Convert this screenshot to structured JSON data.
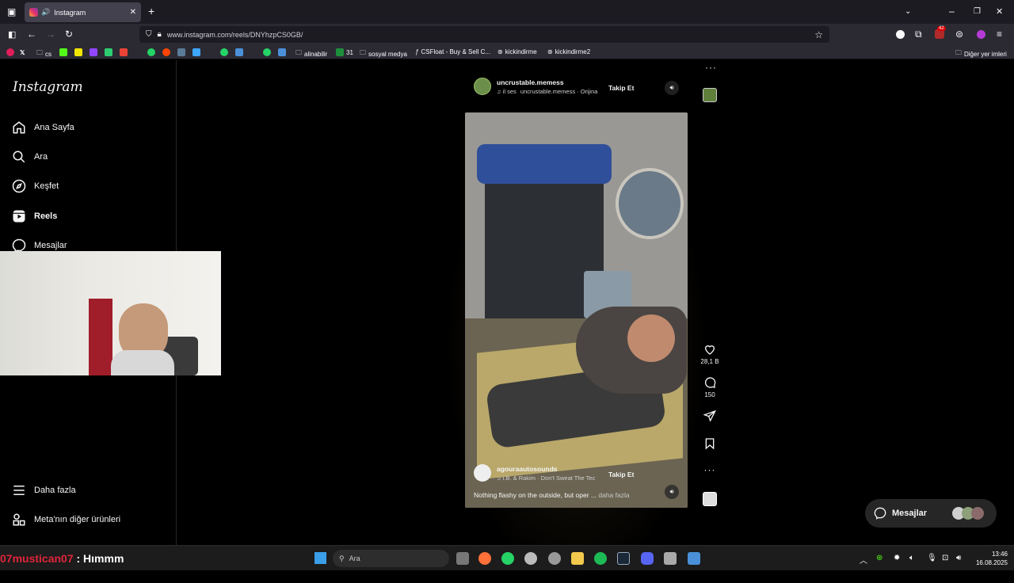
{
  "browser": {
    "tab_title": "Instagram",
    "url": "www.instagram.com/reels/DNYhzpCS0GB/",
    "extension_badge": "42",
    "bookmarks": [
      {
        "label": "cs"
      },
      {
        "label": "alinabilir"
      },
      {
        "label": "31"
      },
      {
        "label": "sosyal medya"
      },
      {
        "label": "CSFloat - Buy & Sell C..."
      },
      {
        "label": "kickindirme"
      },
      {
        "label": "kickindirme2"
      }
    ],
    "other_bookmarks": "Diğer yer imleri"
  },
  "sidebar": {
    "logo": "Instagram",
    "items": [
      {
        "label": "Ana Sayfa",
        "icon": "home-icon"
      },
      {
        "label": "Ara",
        "icon": "search-icon"
      },
      {
        "label": "Keşfet",
        "icon": "compass-icon"
      },
      {
        "label": "Reels",
        "icon": "reels-icon"
      },
      {
        "label": "Mesajlar",
        "icon": "messenger-icon"
      }
    ],
    "bottom_items": [
      {
        "label": "Daha fazla",
        "icon": "menu-icon"
      },
      {
        "label": "Meta'nın diğer ürünleri",
        "icon": "meta-products-icon"
      }
    ]
  },
  "reel_top": {
    "username": "uncrustable.memess",
    "audio_count": "il ses",
    "audio": "uncrustable.memess · Orijina",
    "follow": "Takip Et"
  },
  "reel_current": {
    "username": "agouraautosounds",
    "audio": "i.B. & Rakim · Don't Sweat The Tec",
    "follow": "Takip Et",
    "caption": "Nothing flashy on the outside, but oper ...",
    "more": "daha fazla"
  },
  "actions": {
    "likes": "28,1 B",
    "comments": "150"
  },
  "messages_pill": {
    "label": "Mesajlar"
  },
  "stream_overlay": {
    "user": "07mustican07",
    "message": ": Hımmm"
  },
  "taskbar": {
    "search_placeholder": "Ara",
    "time": "13:46",
    "date": "16.08.2025"
  },
  "colors": {
    "overlay_user": "#e0243a",
    "instagram_bg": "#000000",
    "browser_chrome": "#2b2a33"
  }
}
